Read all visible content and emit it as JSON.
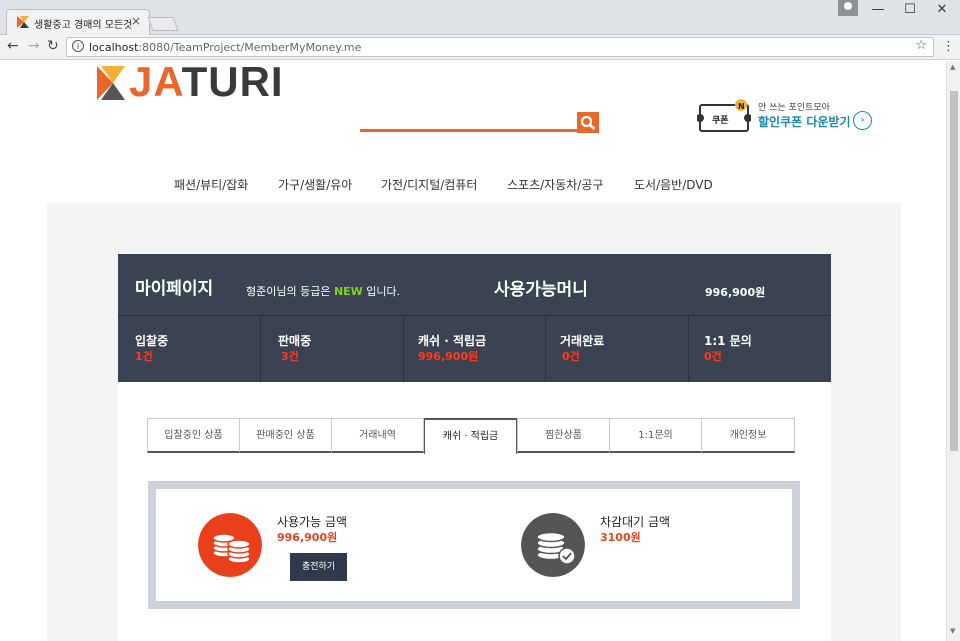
{
  "browser": {
    "tab_title": "생활중고 경매의 모든것",
    "tab_close": "×",
    "url_host": "localhost",
    "url_path": ":8080/TeamProject/MemberMyMoney.me",
    "win_minimize": "—",
    "win_maximize": "☐",
    "win_close": "✕",
    "back": "←",
    "forward": "→",
    "reload": "↻",
    "star": "☆",
    "menu": "⋮",
    "info": "i"
  },
  "header": {
    "logo_ja": "JA",
    "logo_turi": "TURI",
    "coupon_ticket": "쿠폰",
    "coupon_badge": "N",
    "coupon_small": "안 쓰는 포인트모아",
    "coupon_big": "할인쿠폰 다운받기",
    "coupon_arrow": "›"
  },
  "categories": [
    "패션/뷰티/잡화",
    "가구/생활/유아",
    "가전/디지털/컴퓨터",
    "스포츠/자동차/공구",
    "도서/음반/DVD"
  ],
  "mypage": {
    "title": "마이페이지",
    "grade_prefix": "형준이님의 등급은 ",
    "grade": "NEW",
    "grade_suffix": " 입니다.",
    "money_label": "사용가능머니",
    "money_value": "996,900원",
    "stats": [
      {
        "label": "입찰중",
        "value": "1건"
      },
      {
        "label": "판매중",
        "value": "3건"
      },
      {
        "label": "캐쉬 · 적립금",
        "value": "996,900원"
      },
      {
        "label": "거래완료",
        "value": "0건"
      },
      {
        "label": "1:1 문의",
        "value": "0건"
      }
    ]
  },
  "tabs": [
    {
      "label": "입찰중인 상품"
    },
    {
      "label": "판매중인 상품"
    },
    {
      "label": "거래내역"
    },
    {
      "label": "캐쉬 · 적립금"
    },
    {
      "label": "찜한상품"
    },
    {
      "label": "1:1문의"
    },
    {
      "label": "개인정보"
    }
  ],
  "active_tab": "캐쉬 · 적립금",
  "money": {
    "available_label": "사용가능 금액",
    "available_value": "996,900원",
    "charge_button": "충전하기",
    "pending_label": "차감대기 금액",
    "pending_value": "3100원"
  },
  "colors": {
    "brand_orange": "#e8682a",
    "panel_dark": "#3b4353",
    "accent_red": "#ff3a1f",
    "grade_green": "#7ed321",
    "coupon_teal": "#1b8aa8"
  },
  "icons": {
    "search": "search-icon",
    "coin_available": "coin-stack-icon",
    "coin_pending": "coin-check-icon"
  }
}
